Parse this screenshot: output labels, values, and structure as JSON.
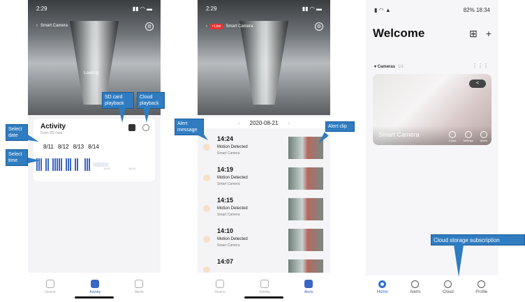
{
  "phone1": {
    "status_time": "2:29",
    "camera_name": "Smart Camera",
    "loading_text": "Loading",
    "activity_title": "Activity",
    "activity_sub": "From SD card",
    "dates": [
      "8/11",
      "8/12",
      "8/13",
      "8/14"
    ],
    "timeline_ticks": [
      "15:00",
      "16:00"
    ],
    "tabs": [
      {
        "label": "Device"
      },
      {
        "label": "Activity"
      },
      {
        "label": "Alerts"
      }
    ]
  },
  "phone2": {
    "status_time": "2:29",
    "live_badge": "• Live",
    "camera_name": "Smart Camera",
    "date": "2020-08-21",
    "items": [
      {
        "time": "14:24",
        "event": "Motion Detected",
        "camera": "Smart Camera"
      },
      {
        "time": "14:19",
        "event": "Motion Detected",
        "camera": "Smart Camera"
      },
      {
        "time": "14:15",
        "event": "Motion Detected",
        "camera": "Smart Camera"
      },
      {
        "time": "14:10",
        "event": "Motion Detected",
        "camera": "Smart Camera"
      },
      {
        "time": "14:07",
        "event": "",
        "camera": ""
      }
    ],
    "tabs": [
      {
        "label": "Device"
      },
      {
        "label": "Activity"
      },
      {
        "label": "Alerts"
      }
    ]
  },
  "phone3": {
    "status_right": "82% 18:34",
    "welcome": "Welcome",
    "cameras_label": "Cameras",
    "cameras_count": "1/1",
    "camera_name": "Smart Camera",
    "card_buttons": [
      "Cloud",
      "Settings",
      "Alerts"
    ],
    "tabs": [
      {
        "label": "Home"
      },
      {
        "label": "Alerts"
      },
      {
        "label": "Cloud"
      },
      {
        "label": "Profile"
      }
    ]
  },
  "callouts": {
    "sd_card": "SD  card\nplayback",
    "cloud_playback": "Cloud\nplayback",
    "select_date": "Select\ndate",
    "select_time": "Select\ntime",
    "alert_message": "Alert\nmessage",
    "alert_clip": "Alert clip",
    "cloud_storage": "Cloud storage subscription"
  },
  "colors": {
    "accent": "#2f7cc1",
    "timeline": "#3a66c4"
  }
}
